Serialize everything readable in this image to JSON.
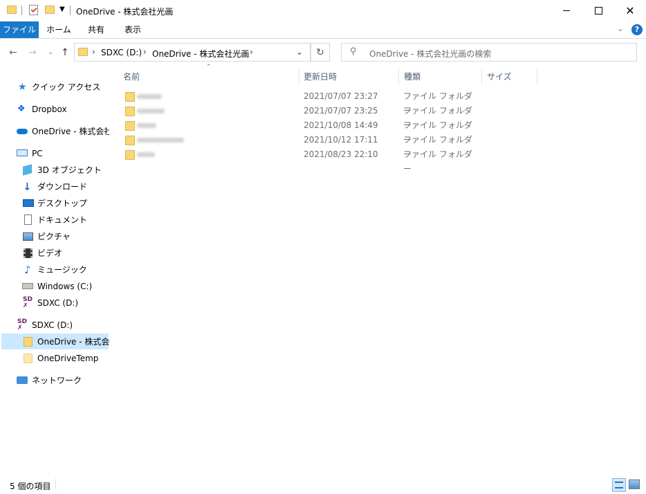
{
  "window": {
    "title": "OneDrive - 株式会社光画",
    "minimize_icon": "minimize-icon",
    "maximize_icon": "maximize-icon",
    "close_icon": "close-icon"
  },
  "ribbon": {
    "tabs": [
      "ファイル",
      "ホーム",
      "共有",
      "表示"
    ]
  },
  "address": {
    "crumbs": [
      "SDXC (D:)",
      "OneDrive - 株式会社光画"
    ]
  },
  "search": {
    "placeholder": "OneDrive - 株式会社光画の検索"
  },
  "nav": {
    "items": [
      {
        "label": "クイック アクセス",
        "icon": "star-icon"
      },
      {
        "label": "Dropbox",
        "icon": "dropbox-icon"
      },
      {
        "label": "OneDrive - 株式会社光",
        "icon": "cloud-icon"
      },
      {
        "label": "PC",
        "icon": "pc-icon"
      },
      {
        "label": "3D オブジェクト",
        "icon": "cube-icon"
      },
      {
        "label": "ダウンロード",
        "icon": "download-icon"
      },
      {
        "label": "デスクトップ",
        "icon": "desktop-icon"
      },
      {
        "label": "ドキュメント",
        "icon": "document-icon"
      },
      {
        "label": "ピクチャ",
        "icon": "picture-icon"
      },
      {
        "label": "ビデオ",
        "icon": "video-icon"
      },
      {
        "label": "ミュージック",
        "icon": "music-icon"
      },
      {
        "label": "Windows  (C:)",
        "icon": "windows-drive-icon"
      },
      {
        "label": "SDXC (D:)",
        "icon": "sd-card-icon"
      },
      {
        "label": "SDXC (D:)",
        "icon": "sd-card-icon"
      },
      {
        "label": "OneDrive - 株式会社",
        "icon": "folder-icon"
      },
      {
        "label": "OneDriveTemp",
        "icon": "folder-icon"
      },
      {
        "label": "ネットワーク",
        "icon": "network-icon"
      }
    ]
  },
  "columns": [
    "名前",
    "更新日時",
    "種類",
    "サイズ"
  ],
  "files": [
    {
      "date": "2021/07/07 23:27",
      "type": "ファイル フォルダー"
    },
    {
      "date": "2021/07/07 23:25",
      "type": "ファイル フォルダー"
    },
    {
      "date": "2021/10/08 14:49",
      "type": "ファイル フォルダー"
    },
    {
      "date": "2021/10/12 17:11",
      "type": "ファイル フォルダー"
    },
    {
      "date": "2021/08/23 22:10",
      "type": "ファイル フォルダー"
    }
  ],
  "status": {
    "count_text": "5 個の項目"
  },
  "colors": {
    "file_tab": "#1979ca",
    "selected_nav": "#cce8ff",
    "help": "#1a74c9"
  }
}
